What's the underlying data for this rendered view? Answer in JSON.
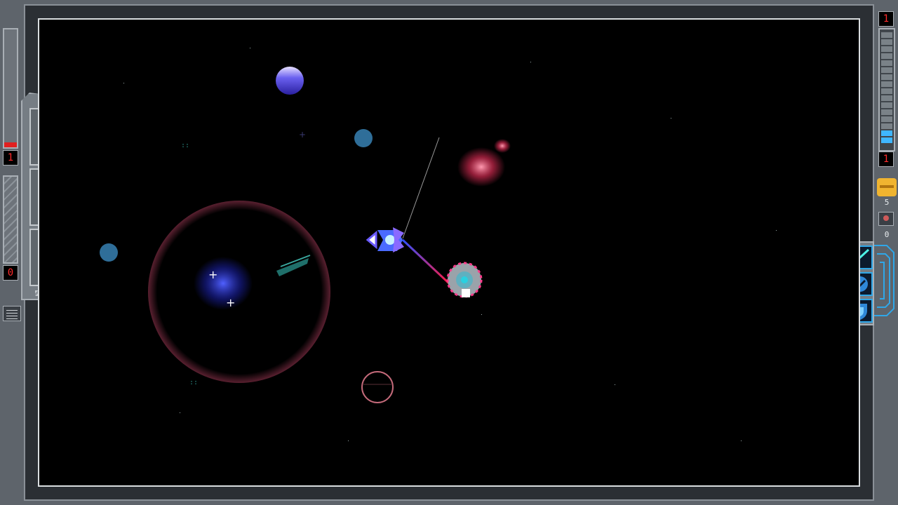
{
  "left_hud": {
    "hull_value": "1",
    "hull_level": 0.04,
    "shield_value": "0"
  },
  "right_hud": {
    "energy_top_value": "1",
    "energy_bottom_value": "1",
    "energy_level": 0.1,
    "credits": "5",
    "crew": "0"
  },
  "cargo": {
    "slots": [
      "",
      "",
      ""
    ]
  },
  "abilities": [
    {
      "icon": "beam-weapon-icon"
    },
    {
      "icon": "repair-tool-icon"
    },
    {
      "icon": "shield-ability-icon"
    }
  ],
  "colors": {
    "hull_red": "#e02020",
    "energy_blue": "#3fb6ff",
    "credit_gold": "#f0b430",
    "laser_start": "#3050ff",
    "laser_end": "#ff1a40"
  }
}
